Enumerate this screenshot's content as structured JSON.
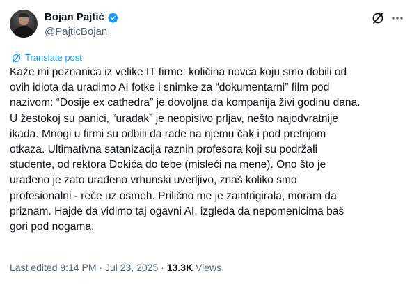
{
  "author": {
    "display_name": "Bojan Pajtić",
    "handle": "@PajticBojan",
    "verified": true
  },
  "colors": {
    "accent": "#1d9bf0",
    "secondary_text": "#536471",
    "primary_text": "#0f1419"
  },
  "icons": {
    "verified": "verified-badge-icon",
    "grok": "grok-icon",
    "more": "more-options-icon",
    "translate": "translate-icon"
  },
  "translate_label": "Translate post",
  "body_lines": [
    "Kaže mi poznanica iz velike IT firme: količina novca koju smo dobili od",
    "ovih idiota da uradimo AI fotke i snimke za “dokumentarni” film pod",
    "nazivom: “Dosije ex cathedra” je dovoljna da kompanija živi godinu dana.",
    "U žestokoj su panici, “uradak” je neopisivo prljav, nešto  najodvratnije",
    "ikada. Mnogi u firmi su odbili da rade na njemu čak i pod pretnjom",
    "otkaza. Ultimativna satanizacija raznih profesora koji su podržali",
    "studente, od rektora Đokića do tebe (misleći na mene). Ono što je",
    "urađeno je zato urađeno vrhunski uverljivo, znaš koliko smo",
    "profesionalni - reče uz osmeh. Prilično me je zaintrigirala, moram da",
    "priznam. Hajde da vidimo taj ogavni AI, izgleda da nepomenicima baš",
    "gori pod nogama."
  ],
  "meta": {
    "edited_label": "Last edited",
    "time": "9:14 PM",
    "separator": "·",
    "date": "Jul 23, 2025",
    "views_count": "13.3K",
    "views_label": "Views"
  }
}
